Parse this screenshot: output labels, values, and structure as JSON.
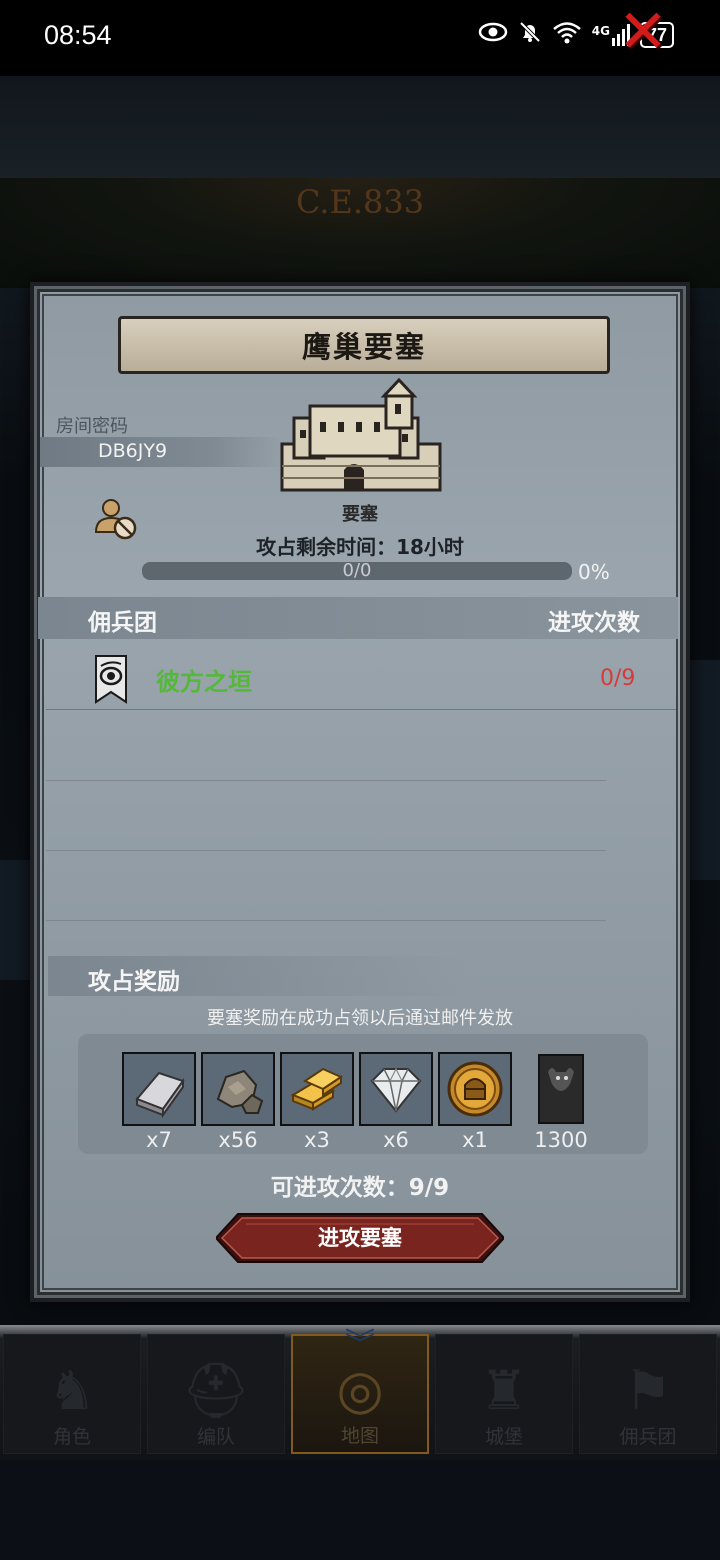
{
  "status_bar": {
    "time": "08:54",
    "icons": [
      "eye-icon",
      "bell-off-icon",
      "wifi-icon",
      "signal-4g-icon"
    ],
    "network": "4G",
    "battery": "77"
  },
  "background": {
    "era": "C.E.833"
  },
  "dialog": {
    "title": "鹰巢要塞",
    "room_label": "房间密码",
    "room_code": "DB6JY9",
    "fortress_type": "要塞",
    "time_remaining": "攻占剩余时间：18小时",
    "progress_text": "0/0",
    "progress_percent": "0%",
    "progress_fraction": 0,
    "table_headers": {
      "mercenary": "佣兵团",
      "attacks": "进攻次数"
    },
    "mercenaries": [
      {
        "name": "彼方之垣",
        "attacks": "0/9"
      }
    ],
    "reward_title": "攻占奖励",
    "reward_note": "要塞奖励在成功占领以后通过邮件发放",
    "rewards": [
      {
        "icon": "silver-ingot-icon",
        "qty": "x7"
      },
      {
        "icon": "stone-ore-icon",
        "qty": "x56"
      },
      {
        "icon": "gold-bars-icon",
        "qty": "x3"
      },
      {
        "icon": "diamond-icon",
        "qty": "x6"
      },
      {
        "icon": "knight-helmet-coin-icon",
        "qty": "x1"
      },
      {
        "icon": "bull-banner-icon",
        "qty": "1300"
      }
    ],
    "attack_count": "可进攻次数：9/9",
    "attack_button": "进攻要塞"
  },
  "bottom_nav": [
    {
      "label": "角色",
      "icon": "knight-icon",
      "active": false
    },
    {
      "label": "编队",
      "icon": "helmet-icon",
      "active": false
    },
    {
      "label": "地图",
      "icon": "map-icon",
      "active": true
    },
    {
      "label": "城堡",
      "icon": "castle-icon",
      "active": false
    },
    {
      "label": "佣兵团",
      "icon": "banner-icon",
      "active": false
    }
  ],
  "colors": {
    "accent_red": "#d21b1b",
    "mercenary_green": "#55b83a",
    "attack_red": "#d63a3a",
    "panel": "#8f9aa3",
    "button_red": "#7a2420"
  }
}
